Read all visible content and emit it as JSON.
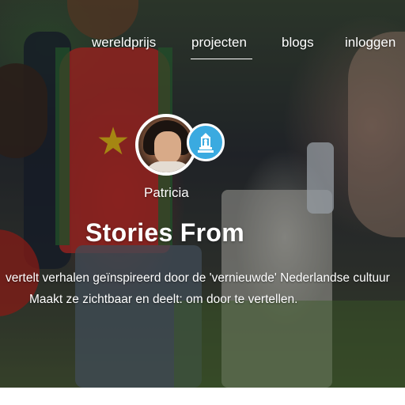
{
  "nav": {
    "items": [
      {
        "label": "wereldprijs"
      },
      {
        "label": "projecten"
      },
      {
        "label": "blogs"
      },
      {
        "label": "inloggen"
      }
    ],
    "active": "projecten"
  },
  "profile": {
    "author": "Patricia",
    "badge_icon": "monument-icon"
  },
  "project": {
    "title": "Stories From",
    "description_line1": "vertelt verhalen geïnspireerd door de 'vernieuwde' Nederlandse cultuur",
    "description_line2": "Maakt ze zichtbaar en deelt: om door te vertellen."
  },
  "colors": {
    "badge": "#3aaae0",
    "text": "#ffffff"
  }
}
